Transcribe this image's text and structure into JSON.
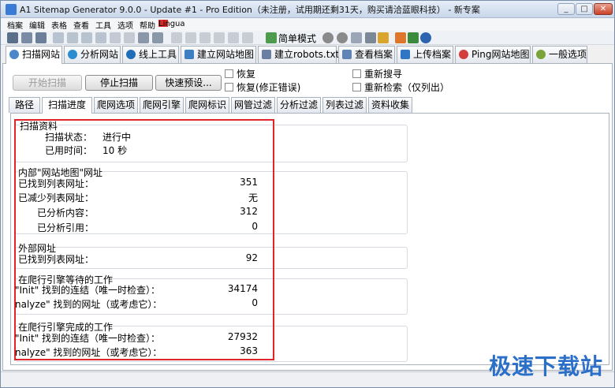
{
  "window": {
    "title": "A1 Sitemap Generator 9.0.0 - Update #1 - Pro Edition（未注册，试用期还剩31天，购买请洽蓝眼科技） - 新专案",
    "controls": [
      "_",
      "□",
      "✕"
    ]
  },
  "menubar": {
    "items": [
      "档案",
      "编辑",
      "表格",
      "查看",
      "工具",
      "选项",
      "帮助"
    ],
    "language": "Lingua"
  },
  "toolbar": {
    "simple_mode_label": "简单模式"
  },
  "main_tabs": [
    {
      "label": "扫描网站",
      "icon": "search-icon",
      "color": "#4a86c8"
    },
    {
      "label": "分析网站",
      "icon": "globe-icon",
      "color": "#2d8bd0"
    },
    {
      "label": "线上工具",
      "icon": "globe-icon",
      "color": "#1f6fb8"
    },
    {
      "label": "建立网站地图",
      "icon": "map-icon",
      "color": "#3d7fc2"
    },
    {
      "label": "建立robots.txt",
      "icon": "filter-icon",
      "color": "#6b7fa3"
    },
    {
      "label": "查看档案",
      "icon": "document-icon",
      "color": "#5f84b5"
    },
    {
      "label": "上传档案",
      "icon": "upload-icon",
      "color": "#2f77c4"
    },
    {
      "label": "Ping网站地图",
      "icon": "signal-icon",
      "color": "#d43d3d"
    },
    {
      "label": "一般选项",
      "icon": "gear-icon",
      "color": "#7aa33a"
    }
  ],
  "scan": {
    "start_label": "开始扫描",
    "stop_label": "停止扫描",
    "preset_label": "快速预设...",
    "resume_label": "恢复",
    "resume_fix_label": "恢复(修正错误)",
    "rescan_label": "重新搜寻",
    "recheck_label": "重新检索（仅列出）"
  },
  "sub_tabs": [
    "路径",
    "扫描进度",
    "爬网选项",
    "爬网引擎",
    "爬网标识",
    "网管过滤",
    "分析过滤",
    "列表过滤",
    "资料收集"
  ],
  "progress": {
    "scan_info": {
      "title": "扫描资料",
      "status_label": "扫描状态：",
      "status_value": "进行中",
      "elapsed_label": "已用时间：",
      "elapsed_value": "10 秒"
    },
    "internal": {
      "title": "内部\"网站地图\"网址",
      "rows": [
        {
          "label": "已找到列表网址：",
          "value": "351"
        },
        {
          "label": "已减少列表网址：",
          "value": "无"
        },
        {
          "label": "已分析内容：",
          "value": "312"
        },
        {
          "label": "已分析引用：",
          "value": "0"
        }
      ]
    },
    "external": {
      "title": "外部网址",
      "rows": [
        {
          "label": "已找到列表网址：",
          "value": "92"
        }
      ]
    },
    "waiting": {
      "title": "在爬行引擎等待的工作",
      "rows": [
        {
          "label": "\"Init\" 找到的连结（唯一时检查）：",
          "value": "34174"
        },
        {
          "label": "nalyze\" 找到的网址（或考虑它）：",
          "value": "0"
        }
      ]
    },
    "done": {
      "title": "在爬行引擎完成的工作",
      "rows": [
        {
          "label": "\"Init\" 找到的连结（唯一时检查）：",
          "value": "27932"
        },
        {
          "label": "nalyze\" 找到的网址（或考虑它）：",
          "value": "363"
        }
      ]
    }
  },
  "watermark": "极速下载站",
  "colors": {
    "highlight": "#e0262b",
    "watermark": "#2b6fc9"
  }
}
